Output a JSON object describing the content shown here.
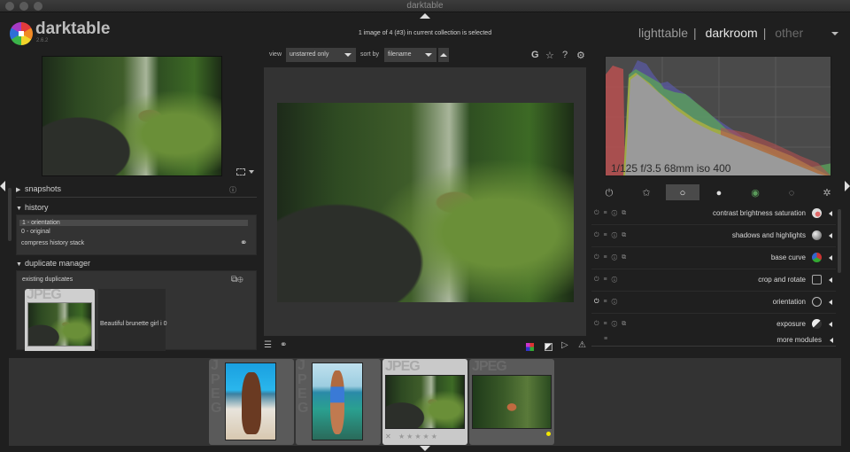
{
  "window": {
    "title": "darktable"
  },
  "app": {
    "name": "darktable",
    "version": "2.6.2"
  },
  "views": {
    "items": [
      "lighttable",
      "darkroom",
      "other"
    ],
    "active": "darkroom",
    "separator": "|"
  },
  "header": {
    "status": "1 image of 4 (#3) in current collection is selected"
  },
  "toolbar": {
    "view_label": "view",
    "view_value": "unstarred only",
    "sort_label": "sort by",
    "sort_value": "filename",
    "icons": {
      "grouping": "G",
      "star": "☆",
      "help": "?",
      "settings": "⚙"
    }
  },
  "left_panel": {
    "snapshots": {
      "label": "snapshots",
      "expanded": false
    },
    "history": {
      "label": "history",
      "expanded": true,
      "items": [
        {
          "label": "1 - orientation",
          "selected": true
        },
        {
          "label": "0 - original",
          "selected": false
        }
      ],
      "compress_label": "compress history stack"
    },
    "duplicate_manager": {
      "label": "duplicate manager",
      "expanded": true,
      "existing_label": "existing duplicates",
      "thumb_format": "JPEG",
      "duplicate_name": "Beautiful brunette girl i  0"
    }
  },
  "histogram": {
    "exif": "1/125 f/3.5 68mm iso 400"
  },
  "module_groups": [
    {
      "name": "active-modules",
      "glyph": "⏻"
    },
    {
      "name": "favorites",
      "glyph": "✩"
    },
    {
      "name": "basic-group",
      "glyph": "○",
      "active": true
    },
    {
      "name": "tone-group",
      "glyph": "●"
    },
    {
      "name": "color-group",
      "glyph": "◉"
    },
    {
      "name": "correct-group",
      "glyph": "◌"
    },
    {
      "name": "effect-group",
      "glyph": "✲"
    }
  ],
  "modules": [
    {
      "name": "contrast brightness saturation",
      "enabled": false,
      "icon_color": "#d86a6a"
    },
    {
      "name": "shadows and highlights",
      "enabled": false,
      "icon_color": "#9a9a9a"
    },
    {
      "name": "base curve",
      "enabled": false,
      "icon_color": "#4f8a4f"
    },
    {
      "name": "crop and rotate",
      "enabled": false,
      "icon_color": "#555555"
    },
    {
      "name": "orientation",
      "enabled": true,
      "icon_color": "#555555"
    },
    {
      "name": "exposure",
      "enabled": false,
      "icon_color": "#cfcfcf"
    }
  ],
  "more_modules": {
    "label": "more modules"
  },
  "filmstrip": {
    "items": [
      {
        "format": "JPEG",
        "selected": false,
        "stars": 0
      },
      {
        "format": "JPEG",
        "selected": false,
        "stars": 0
      },
      {
        "format": "JPEG",
        "selected": true,
        "stars": 0,
        "star_glyphs": "★★★★★",
        "reject": "✕"
      },
      {
        "format": "JPEG",
        "selected": false,
        "stars": 0,
        "color_label": "#f2e600"
      }
    ]
  },
  "colors": {
    "accent_yellow": "#f2e600",
    "panel_bg": "#1f1f1f",
    "center_bg": "#333333"
  }
}
